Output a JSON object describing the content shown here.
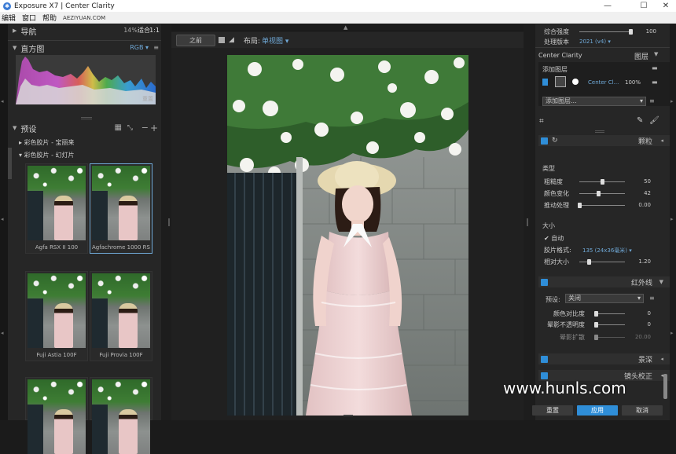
{
  "titlebar": {
    "title": "Exposure X7 | Center Clarity",
    "minimize": "—",
    "maximize": "☐",
    "close": "✕"
  },
  "menubar": {
    "items": [
      "编辑",
      "窗口",
      "帮助"
    ],
    "site": "AEZIYUAN.COM"
  },
  "navigator": {
    "title": "导航",
    "zoom": "14%",
    "fit": "适合",
    "one": "1:1"
  },
  "histogram": {
    "title": "直方图",
    "mode": "RGB",
    "reset": "重置"
  },
  "presets": {
    "title": "预设",
    "groups": [
      "彩色胶片 - 宝丽来",
      "彩色胶片 - 幻灯片"
    ],
    "thumbs": [
      {
        "caption": "Agfa RSX II 100",
        "selected": false
      },
      {
        "caption": "Agfachrome 1000 RS",
        "selected": true
      },
      {
        "caption": "Fuji Astia 100F",
        "selected": false
      },
      {
        "caption": "Fuji Provia 100F",
        "selected": false
      },
      {
        "caption": "",
        "selected": false
      },
      {
        "caption": "",
        "selected": false
      }
    ]
  },
  "center_toolbar": {
    "before": "之前",
    "layout_label": "布局:",
    "layout_value": "单视图"
  },
  "right": {
    "overall_strength": {
      "label": "综合强度",
      "value": "100",
      "fraction": 1.0
    },
    "process_version": {
      "label": "处理版本",
      "value": "2021 (v4)"
    },
    "layer_panel": {
      "name": "Center Clarity",
      "layers_label": "图层"
    },
    "add_layer": "添加图层",
    "layer_row": {
      "name": "Center Cl...",
      "opacity": "100%"
    },
    "add_layer_dropdown": "添加图层...",
    "grain": {
      "title": "颗粒",
      "type_label": "类型",
      "roughness": {
        "label": "粗糙度",
        "value": "50",
        "fraction": 0.5
      },
      "color_variation": {
        "label": "颜色变化",
        "value": "42",
        "fraction": 0.42
      },
      "push_process": {
        "label": "推动处理",
        "value": "0.00",
        "fraction": 0.0
      },
      "size_label": "大小",
      "auto_label": "自动",
      "film_format_label": "胶片格式:",
      "film_format_value": "135 (24x36毫米)",
      "relative_size": {
        "label": "相对大小",
        "value": "1.20",
        "fraction": 0.2
      }
    },
    "infrared": {
      "title": "红外线",
      "preset_label": "预设:",
      "preset_value": "关闭",
      "color_contrast": {
        "label": "颜色对比度",
        "value": "0",
        "fraction": 0.0
      },
      "halation_opacity": {
        "label": "晕影不透明度",
        "value": "0",
        "fraction": 0.0
      },
      "halation_spread": {
        "label": "晕影扩散",
        "value": "20.00",
        "fraction": 0.0
      }
    },
    "depth_of_field": {
      "title": "景深"
    },
    "lens_correction": {
      "title": "镜头校正"
    },
    "buttons": {
      "reset": "重置",
      "apply": "应用",
      "cancel": "取消"
    }
  },
  "watermark": "www.hunls.com",
  "colors": {
    "accent": "#2f8ed8",
    "panel": "#262626",
    "bg": "#1b1b1b"
  }
}
